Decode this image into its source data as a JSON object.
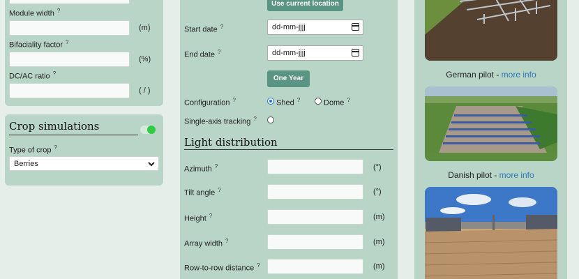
{
  "left": {
    "fields": [
      {
        "label": "Module width",
        "unit": "(m)"
      },
      {
        "label": "Bifaciality factor",
        "unit": "(%)"
      },
      {
        "label": "DC/AC ratio",
        "unit": "( / )"
      }
    ],
    "help_mark": "?",
    "crop": {
      "title": "Crop simulations",
      "type_label": "Type of crop",
      "type_value": "Berries",
      "toggle_on": true
    }
  },
  "middle": {
    "use_location_label": "Use current location",
    "start_date_label": "Start date",
    "end_date_label": "End date",
    "date_placeholder": "dd-mm-jjjj",
    "one_year_label": "One Year",
    "configuration_label": "Configuration",
    "config_options": [
      "Shed",
      "Dome"
    ],
    "config_selected": "Shed",
    "tracking_label": "Single-axis tracking",
    "light_heading": "Light distribution",
    "light_fields": [
      {
        "label": "Azimuth",
        "unit": "(°)"
      },
      {
        "label": "Tilt angle",
        "unit": "(°)"
      },
      {
        "label": "Height",
        "unit": "(m)"
      },
      {
        "label": "Array width",
        "unit": "(m)"
      },
      {
        "label": "Row-to-row distance",
        "unit": "(m)"
      }
    ]
  },
  "right": {
    "pilots": [
      {
        "name": "German pilot - ",
        "link": "more info"
      },
      {
        "name": "Danish pilot - ",
        "link": "more info"
      }
    ]
  },
  "colors": {
    "panel": "#b9d5c7",
    "button": "#5a9483",
    "toggle": "#2ecc40",
    "link": "#2a7ab8"
  }
}
